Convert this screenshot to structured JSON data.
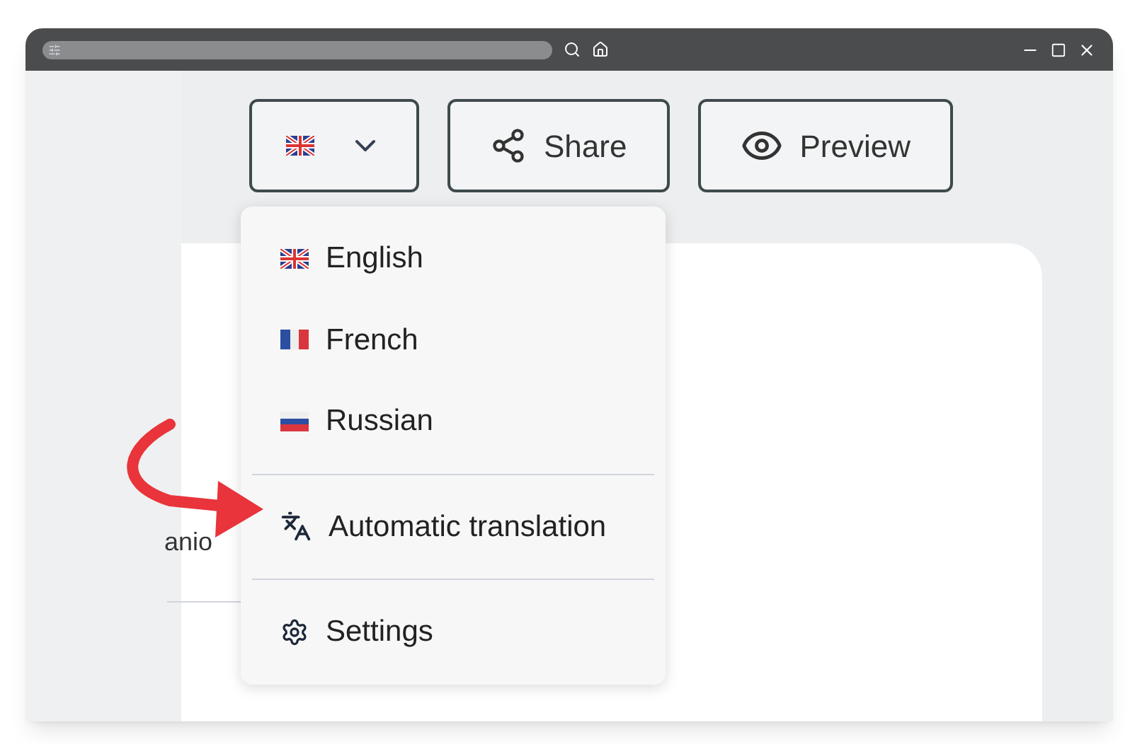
{
  "toolbar": {
    "buttons": [
      {
        "kind": "share",
        "label": "Share"
      },
      {
        "kind": "preview",
        "label": "Preview"
      }
    ]
  },
  "menu": {
    "items": [
      {
        "kind": "gb",
        "label": "English"
      },
      {
        "kind": "fr",
        "label": "French"
      },
      {
        "kind": "ru",
        "label": "Russian"
      },
      {
        "kind": "translate",
        "label": "Automatic translation"
      },
      {
        "kind": "settings",
        "label": "Settings"
      }
    ]
  },
  "background_text": "anio"
}
